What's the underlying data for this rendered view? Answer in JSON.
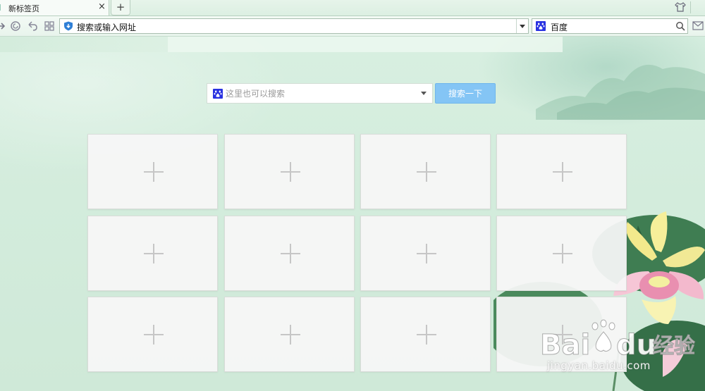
{
  "browser": {
    "tab": {
      "title": "新标签页",
      "close_glyph": "×"
    },
    "new_tab_glyph": "+",
    "toolbar": {
      "icons": [
        "forward-icon",
        "refresh-icon",
        "undo-icon",
        "apps-grid-icon"
      ],
      "address_bar": {
        "icon": "shield-icon",
        "text": "搜索或输入网址"
      },
      "search_engine": {
        "logo": "baidu-paw-icon",
        "name": "百度",
        "search_icon": "magnifier-icon"
      },
      "right_icons": [
        "skin-icon",
        "mail-icon"
      ]
    }
  },
  "page_search": {
    "logo": "baidu-paw-icon",
    "placeholder": "这里也可以搜索",
    "button_label": "搜索一下"
  },
  "tiles": [
    {
      "icon": "plus-icon"
    },
    {
      "icon": "plus-icon"
    },
    {
      "icon": "plus-icon"
    },
    {
      "icon": "plus-icon"
    },
    {
      "icon": "plus-icon"
    },
    {
      "icon": "plus-icon"
    },
    {
      "icon": "plus-icon"
    },
    {
      "icon": "plus-icon"
    },
    {
      "icon": "plus-icon"
    },
    {
      "icon": "plus-icon"
    },
    {
      "icon": "plus-icon"
    },
    {
      "icon": "plus-icon"
    }
  ],
  "watermark": {
    "logo_text": "Baidu经验",
    "site": "jingyan.baidu.com"
  },
  "colors": {
    "background": "#d6eedf",
    "search_button": "#84c5f5",
    "tile": "#f6f6f6",
    "baidu_blue": "#2932e1"
  }
}
